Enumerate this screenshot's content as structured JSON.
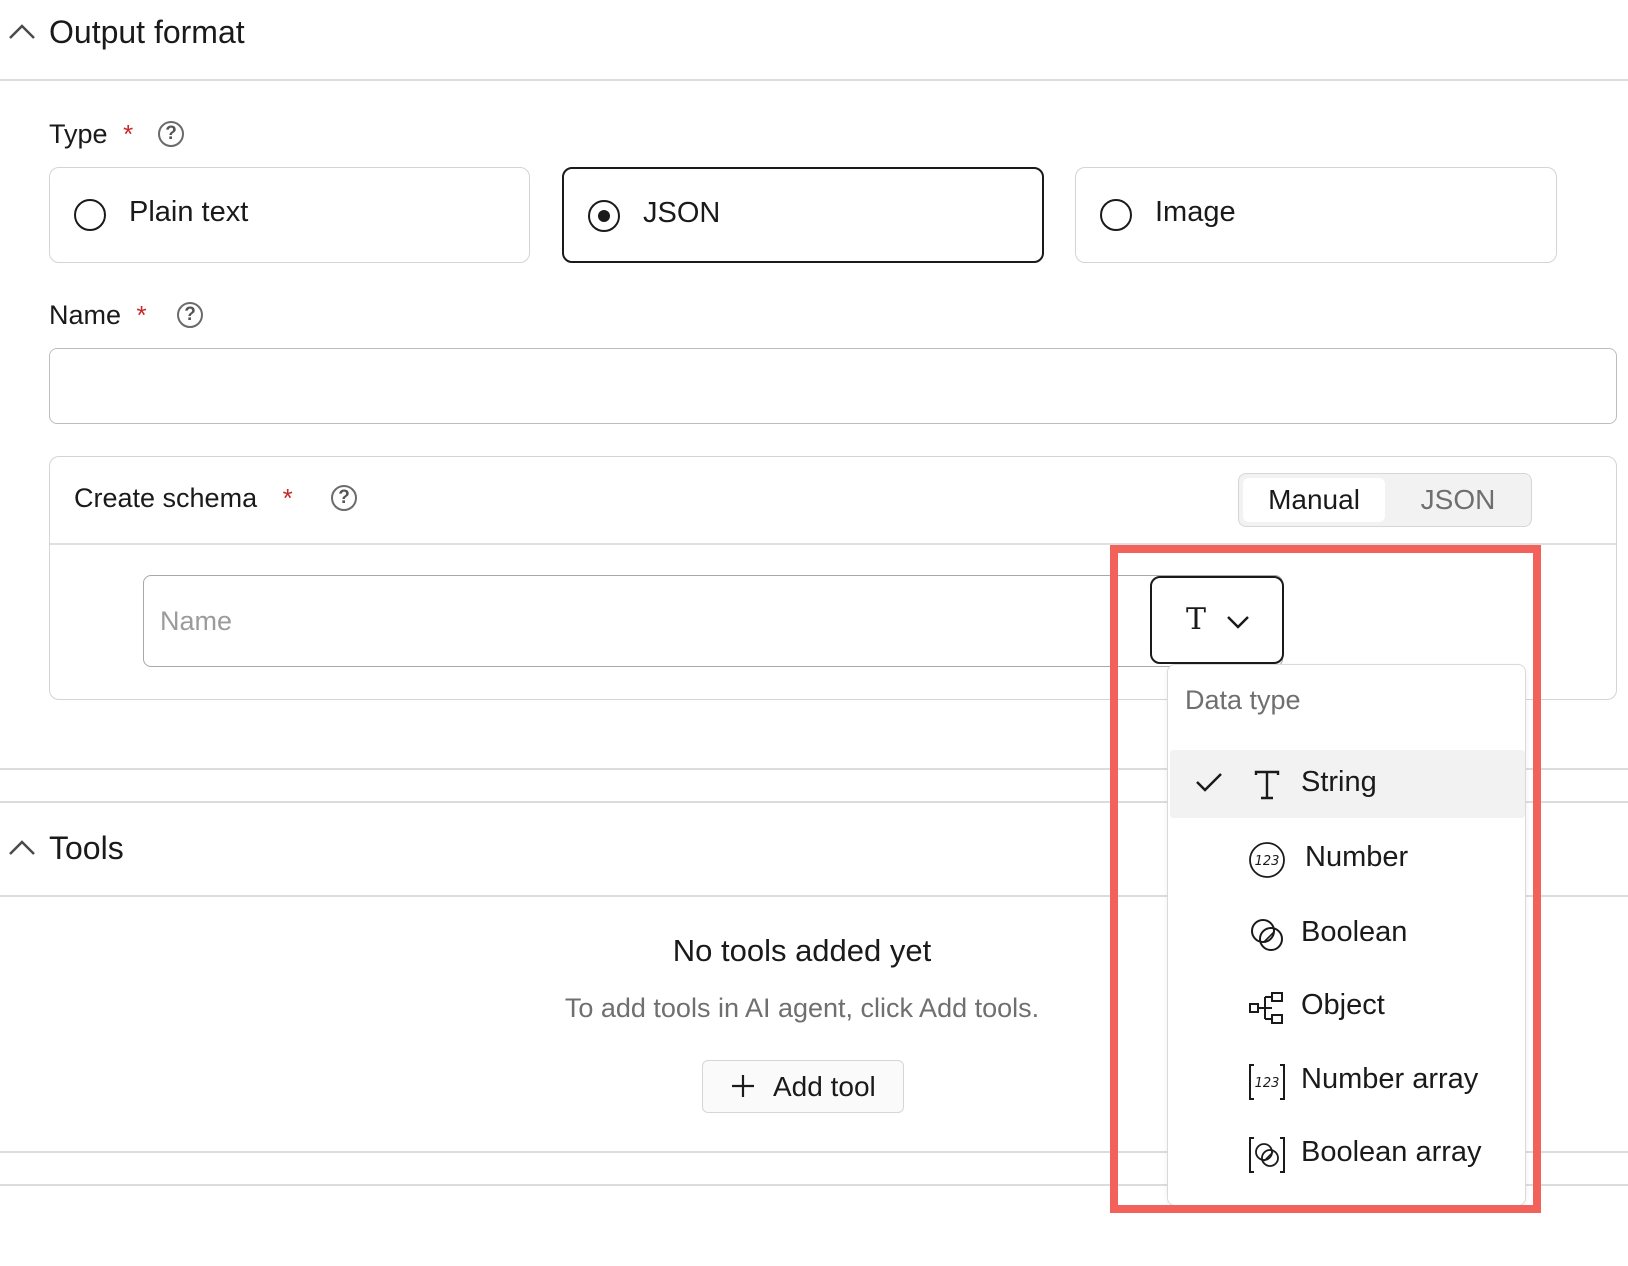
{
  "output_format": {
    "section_title": "Output format",
    "type_label": "Type",
    "required_mark": "*",
    "type_options": [
      {
        "label": "Plain text",
        "selected": false
      },
      {
        "label": "JSON",
        "selected": true
      },
      {
        "label": "Image",
        "selected": false
      }
    ],
    "name_label": "Name",
    "name_value": "",
    "schema": {
      "title": "Create schema",
      "mode_options": [
        "Manual",
        "JSON"
      ],
      "active_mode": "Manual",
      "field_placeholder": "Name",
      "type_button_glyph": "T",
      "data_type_menu": {
        "header": "Data type",
        "items": [
          {
            "label": "String",
            "icon": "text-type-icon",
            "selected": true
          },
          {
            "label": "Number",
            "icon": "number-icon",
            "selected": false
          },
          {
            "label": "Boolean",
            "icon": "boolean-icon",
            "selected": false
          },
          {
            "label": "Object",
            "icon": "object-icon",
            "selected": false
          },
          {
            "label": "Number array",
            "icon": "number-array-icon",
            "selected": false
          },
          {
            "label": "Boolean array",
            "icon": "boolean-array-icon",
            "selected": false
          }
        ]
      }
    }
  },
  "tools": {
    "section_title": "Tools",
    "empty_title": "No tools added yet",
    "empty_subtitle": "To add tools in AI agent, click Add tools.",
    "add_button_label": "Add tool"
  },
  "colors": {
    "highlight": "#f2625b",
    "required": "#c62828",
    "selected_row": "#f2f2f3"
  }
}
